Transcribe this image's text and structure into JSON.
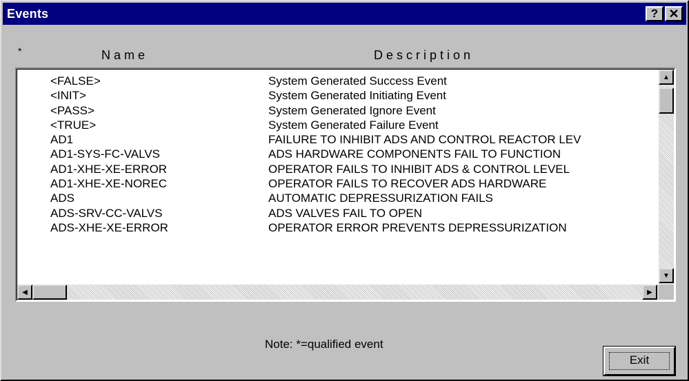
{
  "window": {
    "title": "Events",
    "help_label": "?",
    "close_label": "✕"
  },
  "columns": {
    "qualifier": "*",
    "name": "Name",
    "description": "Description"
  },
  "rows": [
    {
      "name": "<FALSE>",
      "description": "System Generated Success Event"
    },
    {
      "name": "<INIT>",
      "description": "System Generated Initiating Event"
    },
    {
      "name": "<PASS>",
      "description": "System Generated Ignore Event"
    },
    {
      "name": "<TRUE>",
      "description": "System Generated Failure Event"
    },
    {
      "name": "AD1",
      "description": "FAILURE TO INHIBIT ADS AND CONTROL REACTOR LEV"
    },
    {
      "name": "AD1-SYS-FC-VALVS",
      "description": "ADS HARDWARE COMPONENTS FAIL TO FUNCTION"
    },
    {
      "name": "AD1-XHE-XE-ERROR",
      "description": "OPERATOR FAILS TO INHIBIT ADS & CONTROL LEVEL"
    },
    {
      "name": "AD1-XHE-XE-NOREC",
      "description": "OPERATOR FAILS TO RECOVER ADS HARDWARE"
    },
    {
      "name": "ADS",
      "description": "AUTOMATIC DEPRESSURIZATION FAILS"
    },
    {
      "name": "ADS-SRV-CC-VALVS",
      "description": "ADS VALVES  FAIL TO OPEN"
    },
    {
      "name": "ADS-XHE-XE-ERROR",
      "description": "OPERATOR ERROR PREVENTS  DEPRESSURIZATION"
    }
  ],
  "note": "Note: *=qualified event",
  "exit_label": "Exit",
  "icons": {
    "up": "up-arrow-icon",
    "down": "down-arrow-icon",
    "left": "left-arrow-icon",
    "right": "right-arrow-icon"
  }
}
